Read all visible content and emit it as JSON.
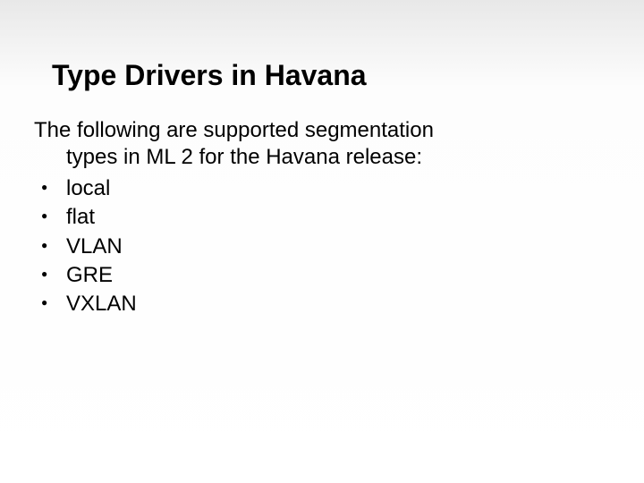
{
  "slide": {
    "title": "Type Drivers in Havana",
    "intro_line1": "The following are supported segmentation",
    "intro_line2": "types in ML 2 for the Havana release:",
    "bullets": {
      "0": "local",
      "1": "flat",
      "2": "VLAN",
      "3": "GRE",
      "4": "VXLAN"
    }
  }
}
